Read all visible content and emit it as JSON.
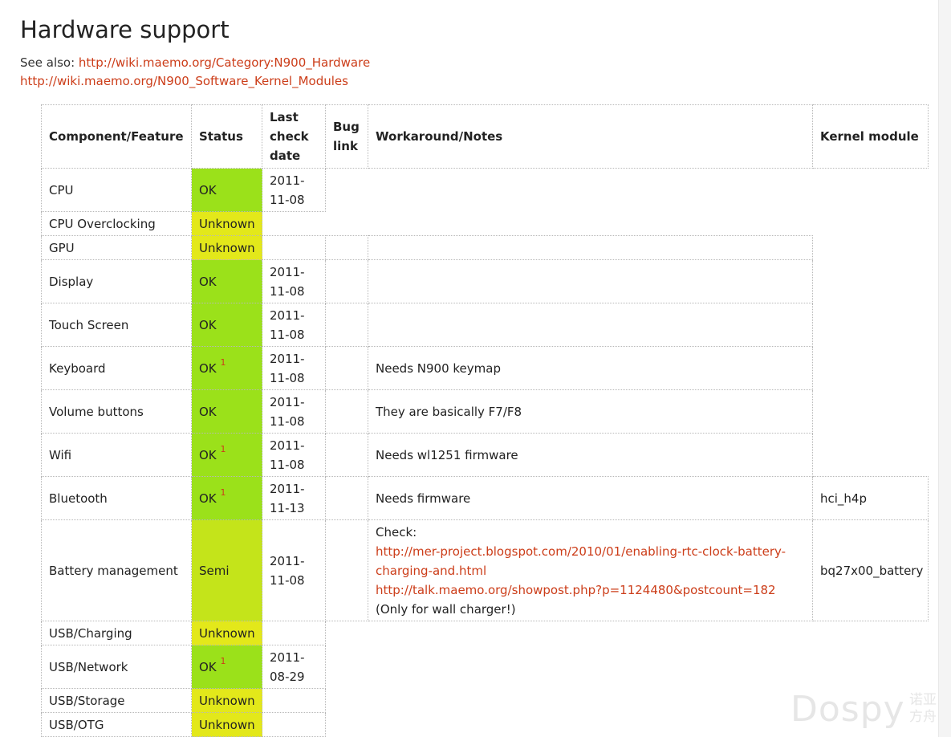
{
  "page": {
    "title": "Hardware support",
    "see_also_label": "See also: ",
    "links": [
      "http://wiki.maemo.org/Category:N900_Hardware",
      "http://wiki.maemo.org/N900_Software_Kernel_Modules"
    ]
  },
  "table": {
    "headers": [
      "Component/Feature",
      "Status",
      "Last check date",
      "Bug link",
      "Workaround/Notes",
      "Kernel module"
    ],
    "rows": [
      {
        "component": "CPU",
        "status": "OK",
        "date": "2011-11-08"
      },
      {
        "component": "CPU Overclocking",
        "status": "Unknown"
      },
      {
        "component": "GPU",
        "status": "Unknown"
      },
      {
        "component": "Display",
        "status": "OK",
        "date": "2011-11-08"
      },
      {
        "component": "Touch Screen",
        "status": "OK",
        "date": "2011-11-08"
      },
      {
        "component": "Keyboard",
        "status": "OK",
        "footnote": "1",
        "date": "2011-11-08",
        "notes": "Needs N900 keymap"
      },
      {
        "component": "Volume buttons",
        "status": "OK",
        "date": "2011-11-08",
        "notes": "They are basically F7/F8"
      },
      {
        "component": "Wifi",
        "status": "OK",
        "footnote": "1",
        "date": "2011-11-08",
        "notes": "Needs wl1251 firmware"
      },
      {
        "component": "Bluetooth",
        "status": "OK",
        "footnote": "1",
        "date": "2011-11-13",
        "notes": "Needs firmware",
        "module": "hci_h4p"
      },
      {
        "component": "Battery management",
        "status": "Semi",
        "date": "2011-11-08",
        "notes_prefix": "Check:",
        "notes_link1": "http://mer-project.blogspot.com/2010/01/enabling-rtc-clock-battery-charging-and.html",
        "notes_link2": "http://talk.maemo.org/showpost.php?p=1124480&postcount=182",
        "notes_suffix": " (Only for wall charger!)",
        "module": "bq27x00_battery"
      },
      {
        "component": "USB/Charging",
        "status": "Unknown"
      },
      {
        "component": "USB/Network",
        "status": "OK",
        "footnote": "1",
        "date": "2011-08-29"
      },
      {
        "component": "USB/Storage",
        "status": "Unknown"
      },
      {
        "component": "USB/OTG",
        "status": "Unknown"
      }
    ]
  },
  "colors": {
    "ok": "#9be11a",
    "semi": "#c4e41a",
    "unknown": "#e3e81a",
    "link": "#cc3d19"
  },
  "watermark": {
    "latin": "Dospy",
    "cn_line1": "诺亚",
    "cn_line2": "方舟"
  }
}
